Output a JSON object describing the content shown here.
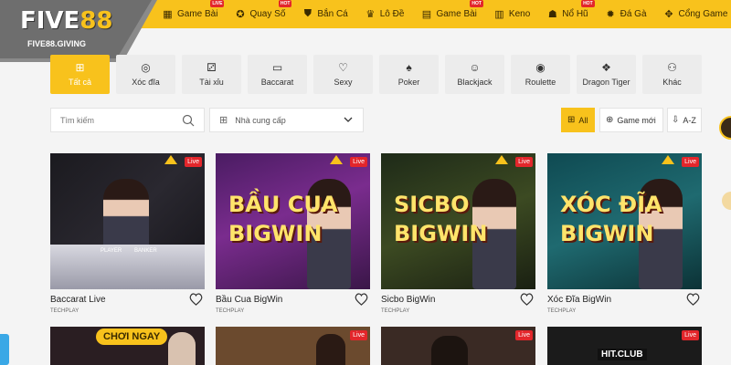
{
  "logo": {
    "brand_main": "FIVE",
    "brand_num": "88",
    "domain": "FIVE88.GIVING"
  },
  "nav": [
    {
      "label": "Game Bài",
      "badge": "LIVE",
      "icon": "cards-icon"
    },
    {
      "label": "Quay Số",
      "badge": "HOT",
      "icon": "ticket-icon"
    },
    {
      "label": "Bắn Cá",
      "badge": "",
      "icon": "fish-icon"
    },
    {
      "label": "Lô Đề",
      "badge": "",
      "icon": "lottery-icon"
    },
    {
      "label": "Game Bài",
      "badge": "HOT",
      "icon": "cards-icon"
    },
    {
      "label": "Keno",
      "badge": "",
      "icon": "keno-icon"
    },
    {
      "label": "Nổ Hũ",
      "badge": "HOT",
      "icon": "jackpot-icon"
    },
    {
      "label": "Đá Gà",
      "badge": "",
      "icon": "rooster-icon"
    },
    {
      "label": "Cổng Game",
      "badge": "",
      "icon": "gamepad-icon"
    }
  ],
  "categories": [
    {
      "label": "Tất cả",
      "icon": "⊞",
      "active": true
    },
    {
      "label": "Xóc đĩa",
      "icon": "◎"
    },
    {
      "label": "Tài xỉu",
      "icon": "⚂"
    },
    {
      "label": "Baccarat",
      "icon": "▭"
    },
    {
      "label": "Sexy",
      "icon": "♡"
    },
    {
      "label": "Poker",
      "icon": "♠"
    },
    {
      "label": "Blackjack",
      "icon": "☺"
    },
    {
      "label": "Roulette",
      "icon": "◉"
    },
    {
      "label": "Dragon Tiger",
      "icon": "❖"
    },
    {
      "label": "Khác",
      "icon": "⚇"
    }
  ],
  "filters": {
    "search_placeholder": "Tìm kiếm",
    "provider_label": "Nhà cung cấp",
    "sort_all": "All",
    "sort_new": "Game mới",
    "sort_az": "A-Z"
  },
  "games": [
    {
      "name": "Baccarat Live",
      "provider": "TECHPLAY",
      "live": "Live",
      "art_title": ""
    },
    {
      "name": "Bầu Cua BigWin",
      "provider": "TECHPLAY",
      "live": "Live",
      "art_title": "BẦU CUA BIGWIN"
    },
    {
      "name": "Sicbo BigWin",
      "provider": "TECHPLAY",
      "live": "Live",
      "art_title": "SICBO BIGWIN"
    },
    {
      "name": "Xóc Đĩa BigWin",
      "provider": "TECHPLAY",
      "live": "Live",
      "art_title": "XÓC ĐĨA BIGWIN"
    }
  ],
  "row2": {
    "play_now": "CHƠI NGAY",
    "live": "Live",
    "hitclub": "HIT.CLUB"
  },
  "art": {
    "line1": [
      "",
      "BẦU CUA",
      "SICBO",
      "XÓC ĐĨA"
    ],
    "line2": [
      "",
      "BIGWIN",
      "BIGWIN",
      "BIGWIN"
    ],
    "player": "PLAYER",
    "banker": "BANKER"
  },
  "colors": {
    "accent": "#f8c21c",
    "live_red": "#e3262b",
    "bg": "#f4f4f4"
  }
}
